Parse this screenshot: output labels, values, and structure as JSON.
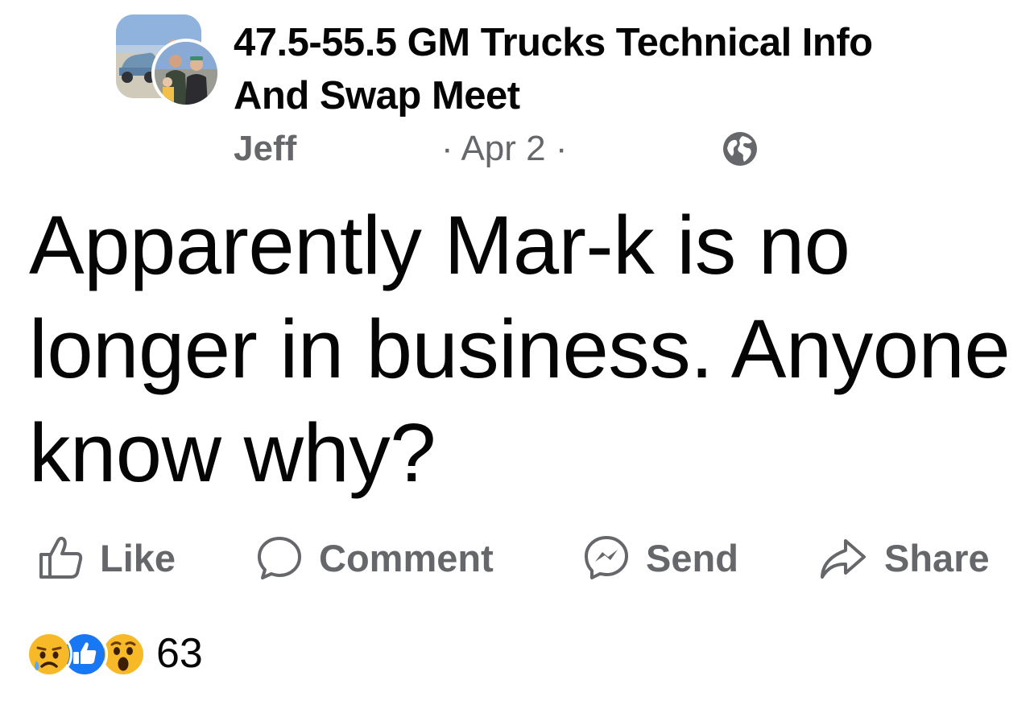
{
  "post": {
    "group_name": "47.5-55.5 GM Trucks Technical Info And Swap Meet",
    "author": "Jeff",
    "date": "· Apr 2 ·",
    "privacy_icon": "globe-icon",
    "text": "Apparently Mar-k is no longer in business. Anyone know why?"
  },
  "actions": {
    "like": {
      "label": "Like",
      "icon": "thumbs-up-outline-icon"
    },
    "comment": {
      "label": "Comment",
      "icon": "speech-bubble-icon"
    },
    "send": {
      "label": "Send",
      "icon": "messenger-icon"
    },
    "share": {
      "label": "Share",
      "icon": "share-arrow-icon"
    }
  },
  "reactions": {
    "icons": [
      "sad-reaction-icon",
      "like-reaction-icon",
      "wow-reaction-icon"
    ],
    "count": "63",
    "colors": {
      "like": "#1877f2",
      "emoji": "#f7b928",
      "text_secondary": "#65676b"
    }
  }
}
